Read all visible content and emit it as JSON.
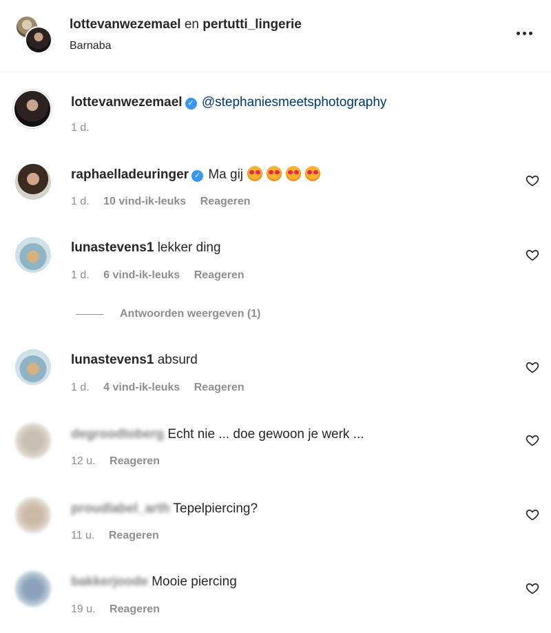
{
  "header": {
    "user1": "lottevanwezemael",
    "joiner": "en",
    "user2": "pertutti_lingerie",
    "location": "Barnaba"
  },
  "caption": {
    "username": "lottevanwezemael",
    "mention": "@stephaniesmeetsphotography",
    "time": "1 d."
  },
  "comments": [
    {
      "username": "raphaelladeuringer",
      "text": "Ma gij",
      "time": "1 d.",
      "likes": "10 vind-ik-leuks",
      "reply": "Reageren"
    },
    {
      "username": "lunastevens1",
      "text": "lekker ding",
      "time": "1 d.",
      "likes": "6 vind-ik-leuks",
      "reply": "Reageren"
    },
    {
      "username": "lunastevens1",
      "text": "absurd",
      "time": "1 d.",
      "likes": "4 vind-ik-leuks",
      "reply": "Reageren"
    },
    {
      "username": "degroodtoberg",
      "text": "Echt nie ... doe gewoon je werk ...",
      "time": "12 u.",
      "reply": "Reageren"
    },
    {
      "username": "proudlabel_arth",
      "text": "Tepelpiercing?",
      "time": "11 u.",
      "reply": "Reageren"
    },
    {
      "username": "bakkerjoode",
      "text": "Mooie piercing",
      "time": "19 u.",
      "reply": "Reageren"
    }
  ],
  "view_replies": "Antwoorden weergeven (1)",
  "colors": {
    "verified": "#3897f0",
    "link": "#00376b",
    "muted": "#8e8e8e"
  },
  "icons": {
    "more": "more-options-icon",
    "like": "heart-outline-icon",
    "verified": "verified-badge-icon"
  }
}
